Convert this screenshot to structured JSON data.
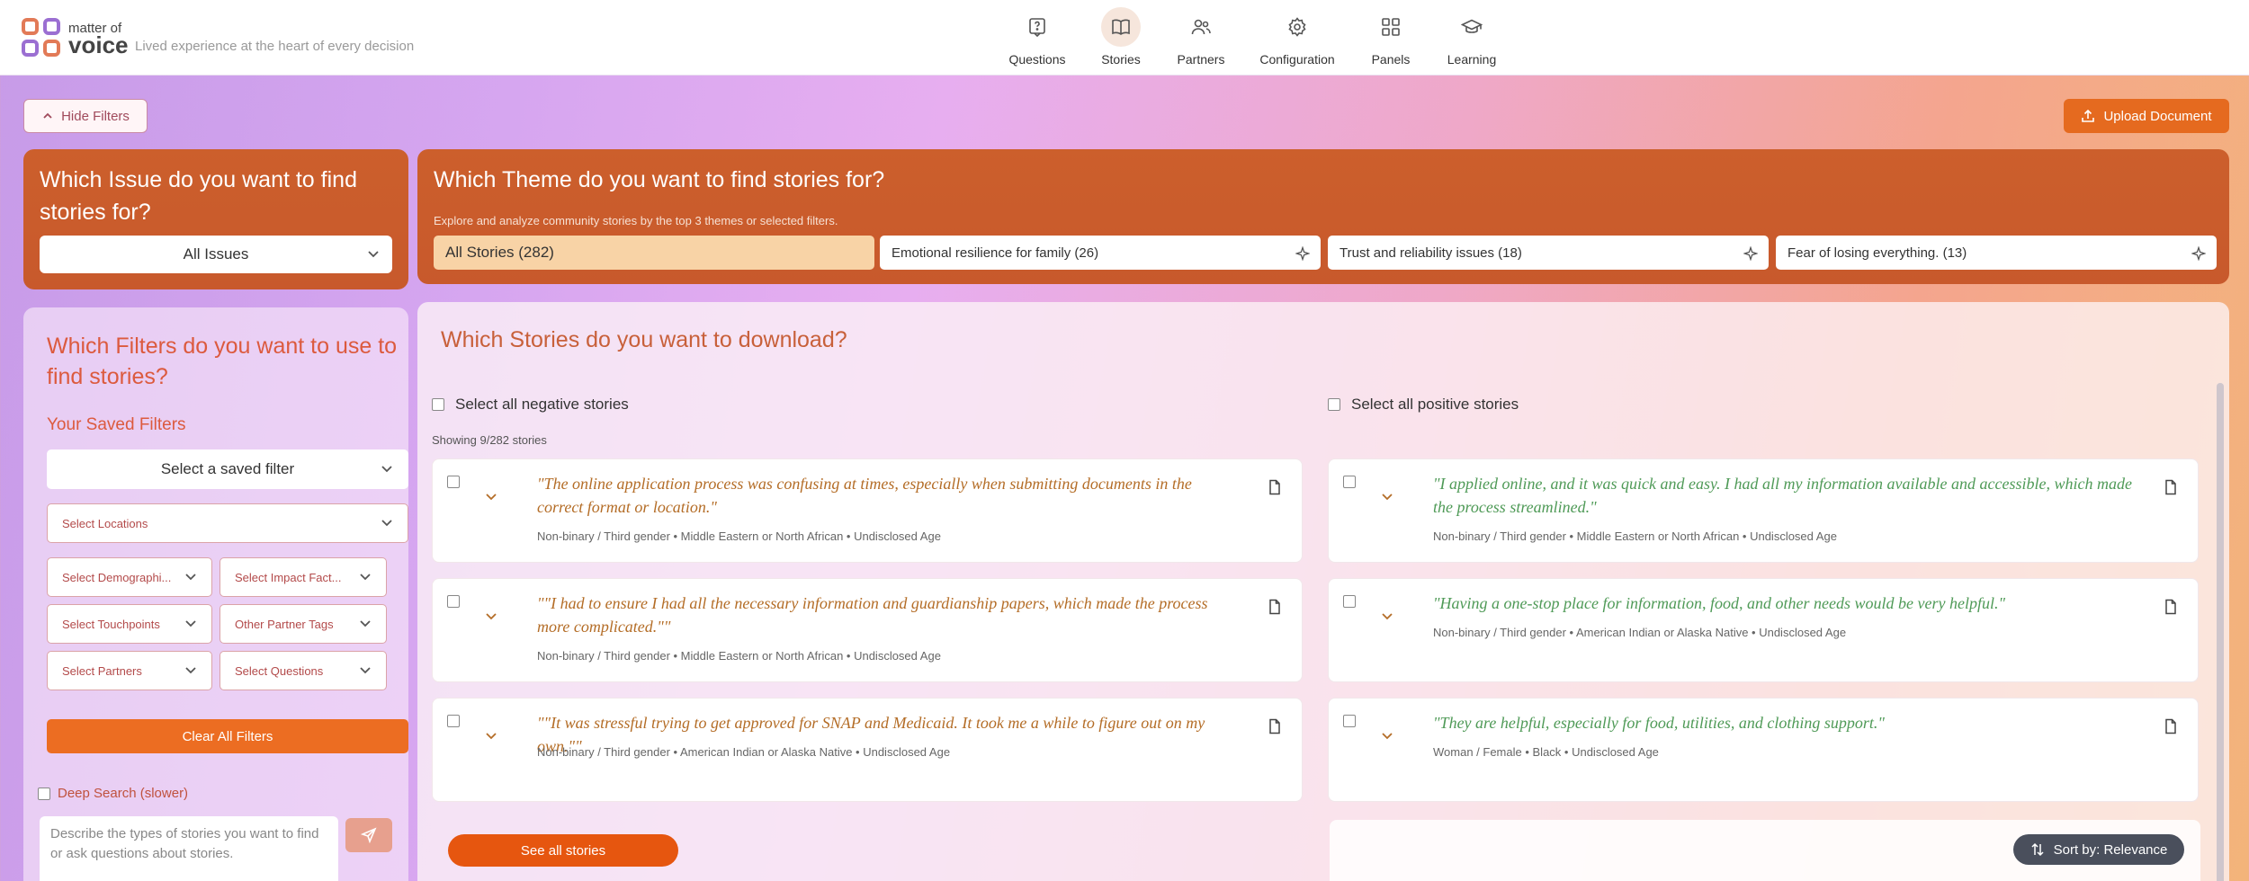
{
  "header": {
    "brand_small": "matter of",
    "brand_big": "voice",
    "tagline": "Lived experience at the heart of every decision",
    "nav": [
      {
        "label": "Questions",
        "icon": "question-icon"
      },
      {
        "label": "Stories",
        "icon": "book-icon",
        "active": true
      },
      {
        "label": "Partners",
        "icon": "users-icon"
      },
      {
        "label": "Configuration",
        "icon": "gear-icon"
      },
      {
        "label": "Panels",
        "icon": "grid-icon"
      },
      {
        "label": "Learning",
        "icon": "graduation-cap-icon"
      }
    ]
  },
  "toolbar": {
    "hide_filters": "Hide Filters",
    "upload": "Upload Document"
  },
  "issue": {
    "question": "Which Issue do you want to find stories for?",
    "selected": "All Issues"
  },
  "theme": {
    "question": "Which Theme do you want to find stories for?",
    "subtitle": "Explore and analyze community stories by the top 3 themes or selected filters.",
    "chips": [
      {
        "label": "All Stories (282)",
        "active": true
      },
      {
        "label": "Emotional resilience for family (26)"
      },
      {
        "label": "Trust and reliability issues (18)"
      },
      {
        "label": "Fear of losing everything. (13)"
      }
    ]
  },
  "filters": {
    "question": "Which Filters do you want to use to find stories?",
    "saved_label": "Your Saved Filters",
    "saved_placeholder": "Select a saved filter",
    "locations": "Select Locations",
    "demographics": "Select Demographi...",
    "impact": "Select Impact Fact...",
    "touchpoints": "Select Touchpoints",
    "partner_tags": "Other Partner Tags",
    "partners": "Select Partners",
    "questions": "Select Questions",
    "clear": "Clear All Filters",
    "deep_search": "Deep Search (slower)",
    "ask_placeholder": "Describe the types of stories you want to find or ask questions about stories."
  },
  "stories": {
    "question": "Which Stories do you want to download?",
    "select_negative": "Select all negative stories",
    "select_positive": "Select all positive stories",
    "showing": "Showing 9/282 stories",
    "negative": [
      {
        "quote": "\"The online application process was confusing at times, especially when submitting documents in the correct format or location.\"",
        "meta": "Non-binary / Third gender • Middle Eastern or North African • Undisclosed Age"
      },
      {
        "quote": "\"\"I had to ensure I had all the necessary information and guardianship papers, which made the process more complicated.\"\"",
        "meta": "Non-binary / Third gender • Middle Eastern or North African • Undisclosed Age"
      },
      {
        "quote": "\"\"It was stressful trying to get approved for SNAP and Medicaid. It took me a while to figure out on my own.\"\"",
        "meta": "Non-binary / Third gender • American Indian or Alaska Native • Undisclosed Age"
      }
    ],
    "positive": [
      {
        "quote": "\"I applied online, and it was quick and easy. I had all my information available and accessible, which made the process streamlined.\"",
        "meta": "Non-binary / Third gender • Middle Eastern or North African • Undisclosed Age"
      },
      {
        "quote": "\"Having a one-stop place for information, food, and other needs would be very helpful.\"",
        "meta": "Non-binary / Third gender • American Indian or Alaska Native • Undisclosed Age"
      },
      {
        "quote": "\"They are helpful, especially for food, utilities, and clothing support.\"",
        "meta": "Woman / Female • Black • Undisclosed Age"
      }
    ],
    "see_all": "See all stories",
    "sort": "Sort by: Relevance"
  },
  "colors": {
    "accent": "#e56a1f",
    "panel": "#cc5f2c",
    "negative_quote": "#b46d27",
    "positive_quote": "#4f9a57"
  }
}
